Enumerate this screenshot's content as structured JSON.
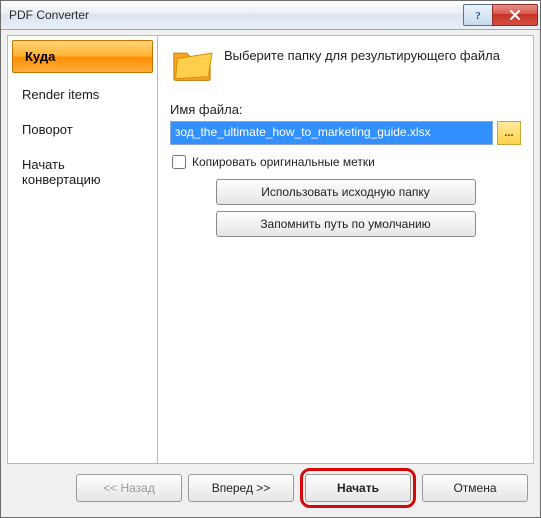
{
  "window": {
    "title": "PDF Converter"
  },
  "sidebar": {
    "items": [
      {
        "label": "Куда",
        "active": true
      },
      {
        "label": "Render items"
      },
      {
        "label": "Поворот"
      },
      {
        "label": "Начать конвертацию"
      }
    ]
  },
  "content": {
    "header": "Выберите папку для результирующего файла",
    "filename_label": "Имя файла:",
    "filename_value": "зод_the_ultimate_how_to_marketing_guide.xlsx",
    "browse_label": "...",
    "checkbox_label": "Копировать оригинальные метки",
    "btn_use_source": "Использовать исходную папку",
    "btn_remember": "Запомнить путь по умолчанию"
  },
  "footer": {
    "back": "<< Назад",
    "next": "Вперед >>",
    "start": "Начать",
    "cancel": "Отмена"
  }
}
